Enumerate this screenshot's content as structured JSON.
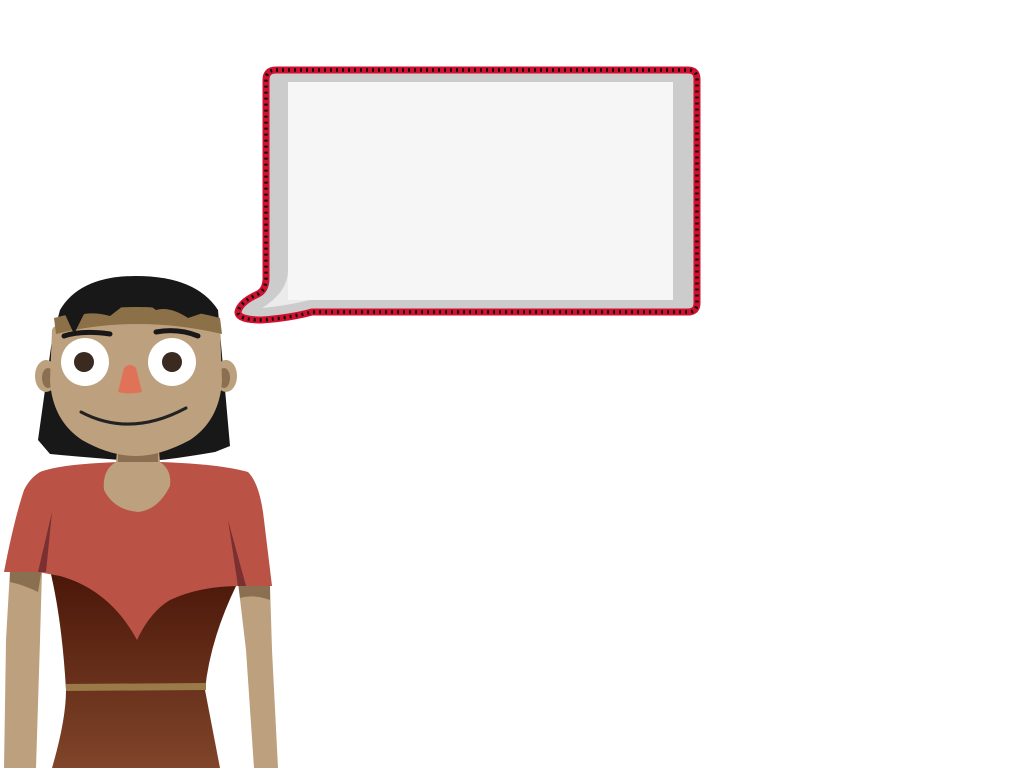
{
  "scene": {
    "background": "#ffffff",
    "speech_bubble": {
      "text": "",
      "border_color": "#d0102f",
      "stitch_color": "#111111",
      "frame_color": "#cccccc",
      "panel_color": "#f6f6f6"
    },
    "character": {
      "hair_color": "#181818",
      "skin_color": "#bda07e",
      "headband_color": "#8c7148",
      "nose_color": "#e07258",
      "shirt_color": "#bb5246",
      "dress_top_color": "#4a1608",
      "dress_bottom_color": "#80452a",
      "belt_color": "#9a7a48"
    }
  }
}
